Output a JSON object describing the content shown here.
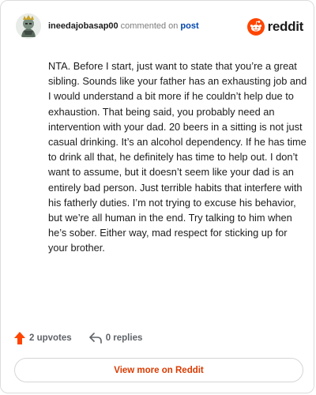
{
  "comment": {
    "username": "ineedajobasap00",
    "action_text": "commented on",
    "post_link": "post",
    "text": "NTA. Before I start, just want to state that you’re a great sibling. Sounds like your father has an exhausting job and I would understand a bit more if he couldn’t help due to exhaustion. That being said, you probably need an intervention with your dad. 20 beers in a sitting is not just casual drinking. It’s an alcohol dependency. If he has time to drink all that, he definitely has time to help out. I don’t want to assume, but it doesn’t seem like your dad is an entirely bad person. Just terrible habits that interfere with his fatherly duties. I’m not trying to excuse his behavior, but we’re all human in the end. Try talking to him when he’s sober. Either way, mad respect for sticking up for your brother.",
    "upvotes": "2 upvotes",
    "replies": "0 replies"
  },
  "brand": {
    "name": "reddit",
    "color": "#ff4500"
  },
  "view_more_label": "View more on Reddit",
  "icons": {
    "upvote": "upvote-arrow-icon",
    "reply": "reply-arrow-icon",
    "logo": "reddit-snoo-icon",
    "avatar": "user-avatar"
  },
  "colors": {
    "upvote": "#ff4500",
    "link": "#0045ac",
    "view_more": "#d93a00"
  }
}
